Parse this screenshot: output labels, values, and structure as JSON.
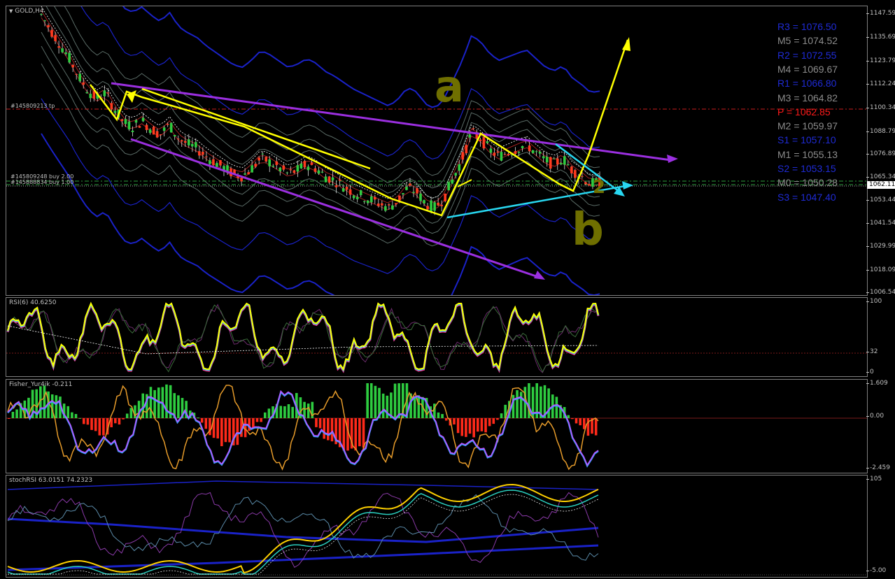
{
  "window": {
    "symbol_label": "GOLD,H4",
    "menu_icon": "triangle-down-icon"
  },
  "main_scale": [
    "1147.59",
    "1135.69",
    "1123.79",
    "1112.24",
    "1100.34",
    "1088.79",
    "1076.89",
    "1065.34",
    "1053.44",
    "1041.54",
    "1029.99",
    "1018.09",
    "1006.54"
  ],
  "current_price": "1062.11",
  "orders": [
    {
      "text": "#145809213 tp"
    },
    {
      "text": "#145809248 buy 2.00"
    },
    {
      "text": "#145888834 buy 1.00"
    }
  ],
  "pivots": [
    {
      "label": "R3 = 1076.50",
      "color": "#1f2bd6"
    },
    {
      "label": "M5 = 1074.52",
      "color": "#8c8c8c"
    },
    {
      "label": "R2 = 1072.55",
      "color": "#1f2bd6"
    },
    {
      "label": "M4 = 1069.67",
      "color": "#8c8c8c"
    },
    {
      "label": "R1 = 1066.80",
      "color": "#1f2bd6"
    },
    {
      "label": "M3 = 1064.82",
      "color": "#8c8c8c"
    },
    {
      "label": "P  = 1062.85",
      "color": "#ff1a1a"
    },
    {
      "label": "M2 = 1059.97",
      "color": "#8c8c8c"
    },
    {
      "label": "S1 = 1057.10",
      "color": "#1f2bd6"
    },
    {
      "label": "M1 = 1055.13",
      "color": "#8c8c8c"
    },
    {
      "label": "S2 = 1053.15",
      "color": "#1f2bd6"
    },
    {
      "label": "M0 = 1050.28",
      "color": "#8c8c8c"
    },
    {
      "label": "S3 = 1047.40",
      "color": "#1f2bd6"
    }
  ],
  "rsi": {
    "label": "RSI(6) 40.6250",
    "scale": [
      "100",
      "32",
      "0"
    ]
  },
  "fisher": {
    "label": "Fisher_Yur4ik -0.211",
    "scale": [
      "1.609",
      "0.00",
      "-2.459"
    ]
  },
  "stochrsi": {
    "label": "stochRSI 63.0151 74.2323",
    "scale": [
      "105",
      "-5.00"
    ]
  },
  "annotations": {
    "wave_a": "a",
    "wave_b": "b",
    "wave_2": "2"
  },
  "colors": {
    "bull": "#2ecc40",
    "bear": "#ff3b1f",
    "yellow": "#ffff00",
    "purple": "#9b2fe0",
    "cyan": "#28d7f0",
    "blue": "#1a22c8",
    "olive": "#777700"
  },
  "chart_data": {
    "type": "line",
    "title": "GOLD,H4",
    "ylim": [
      1006.54,
      1147.59
    ],
    "close_path": [
      1147.6,
      1140,
      1133,
      1126,
      1117,
      1110,
      1105,
      1108,
      1100,
      1093,
      1091,
      1094,
      1090,
      1087,
      1092,
      1085,
      1082,
      1080,
      1076,
      1073,
      1070,
      1067,
      1066,
      1070,
      1075,
      1073,
      1070,
      1067,
      1069,
      1072,
      1070,
      1066,
      1064,
      1061,
      1058,
      1056,
      1054,
      1052,
      1050,
      1054,
      1060,
      1058,
      1052,
      1050,
      1055,
      1065,
      1075,
      1088,
      1085,
      1079,
      1076,
      1078,
      1080,
      1082,
      1078,
      1074,
      1072,
      1075,
      1069,
      1066,
      1062,
      1063
    ],
    "rsi_last": 40.625,
    "fisher_last": -0.211,
    "stochrsi_last": [
      63.0151,
      74.2323
    ]
  }
}
